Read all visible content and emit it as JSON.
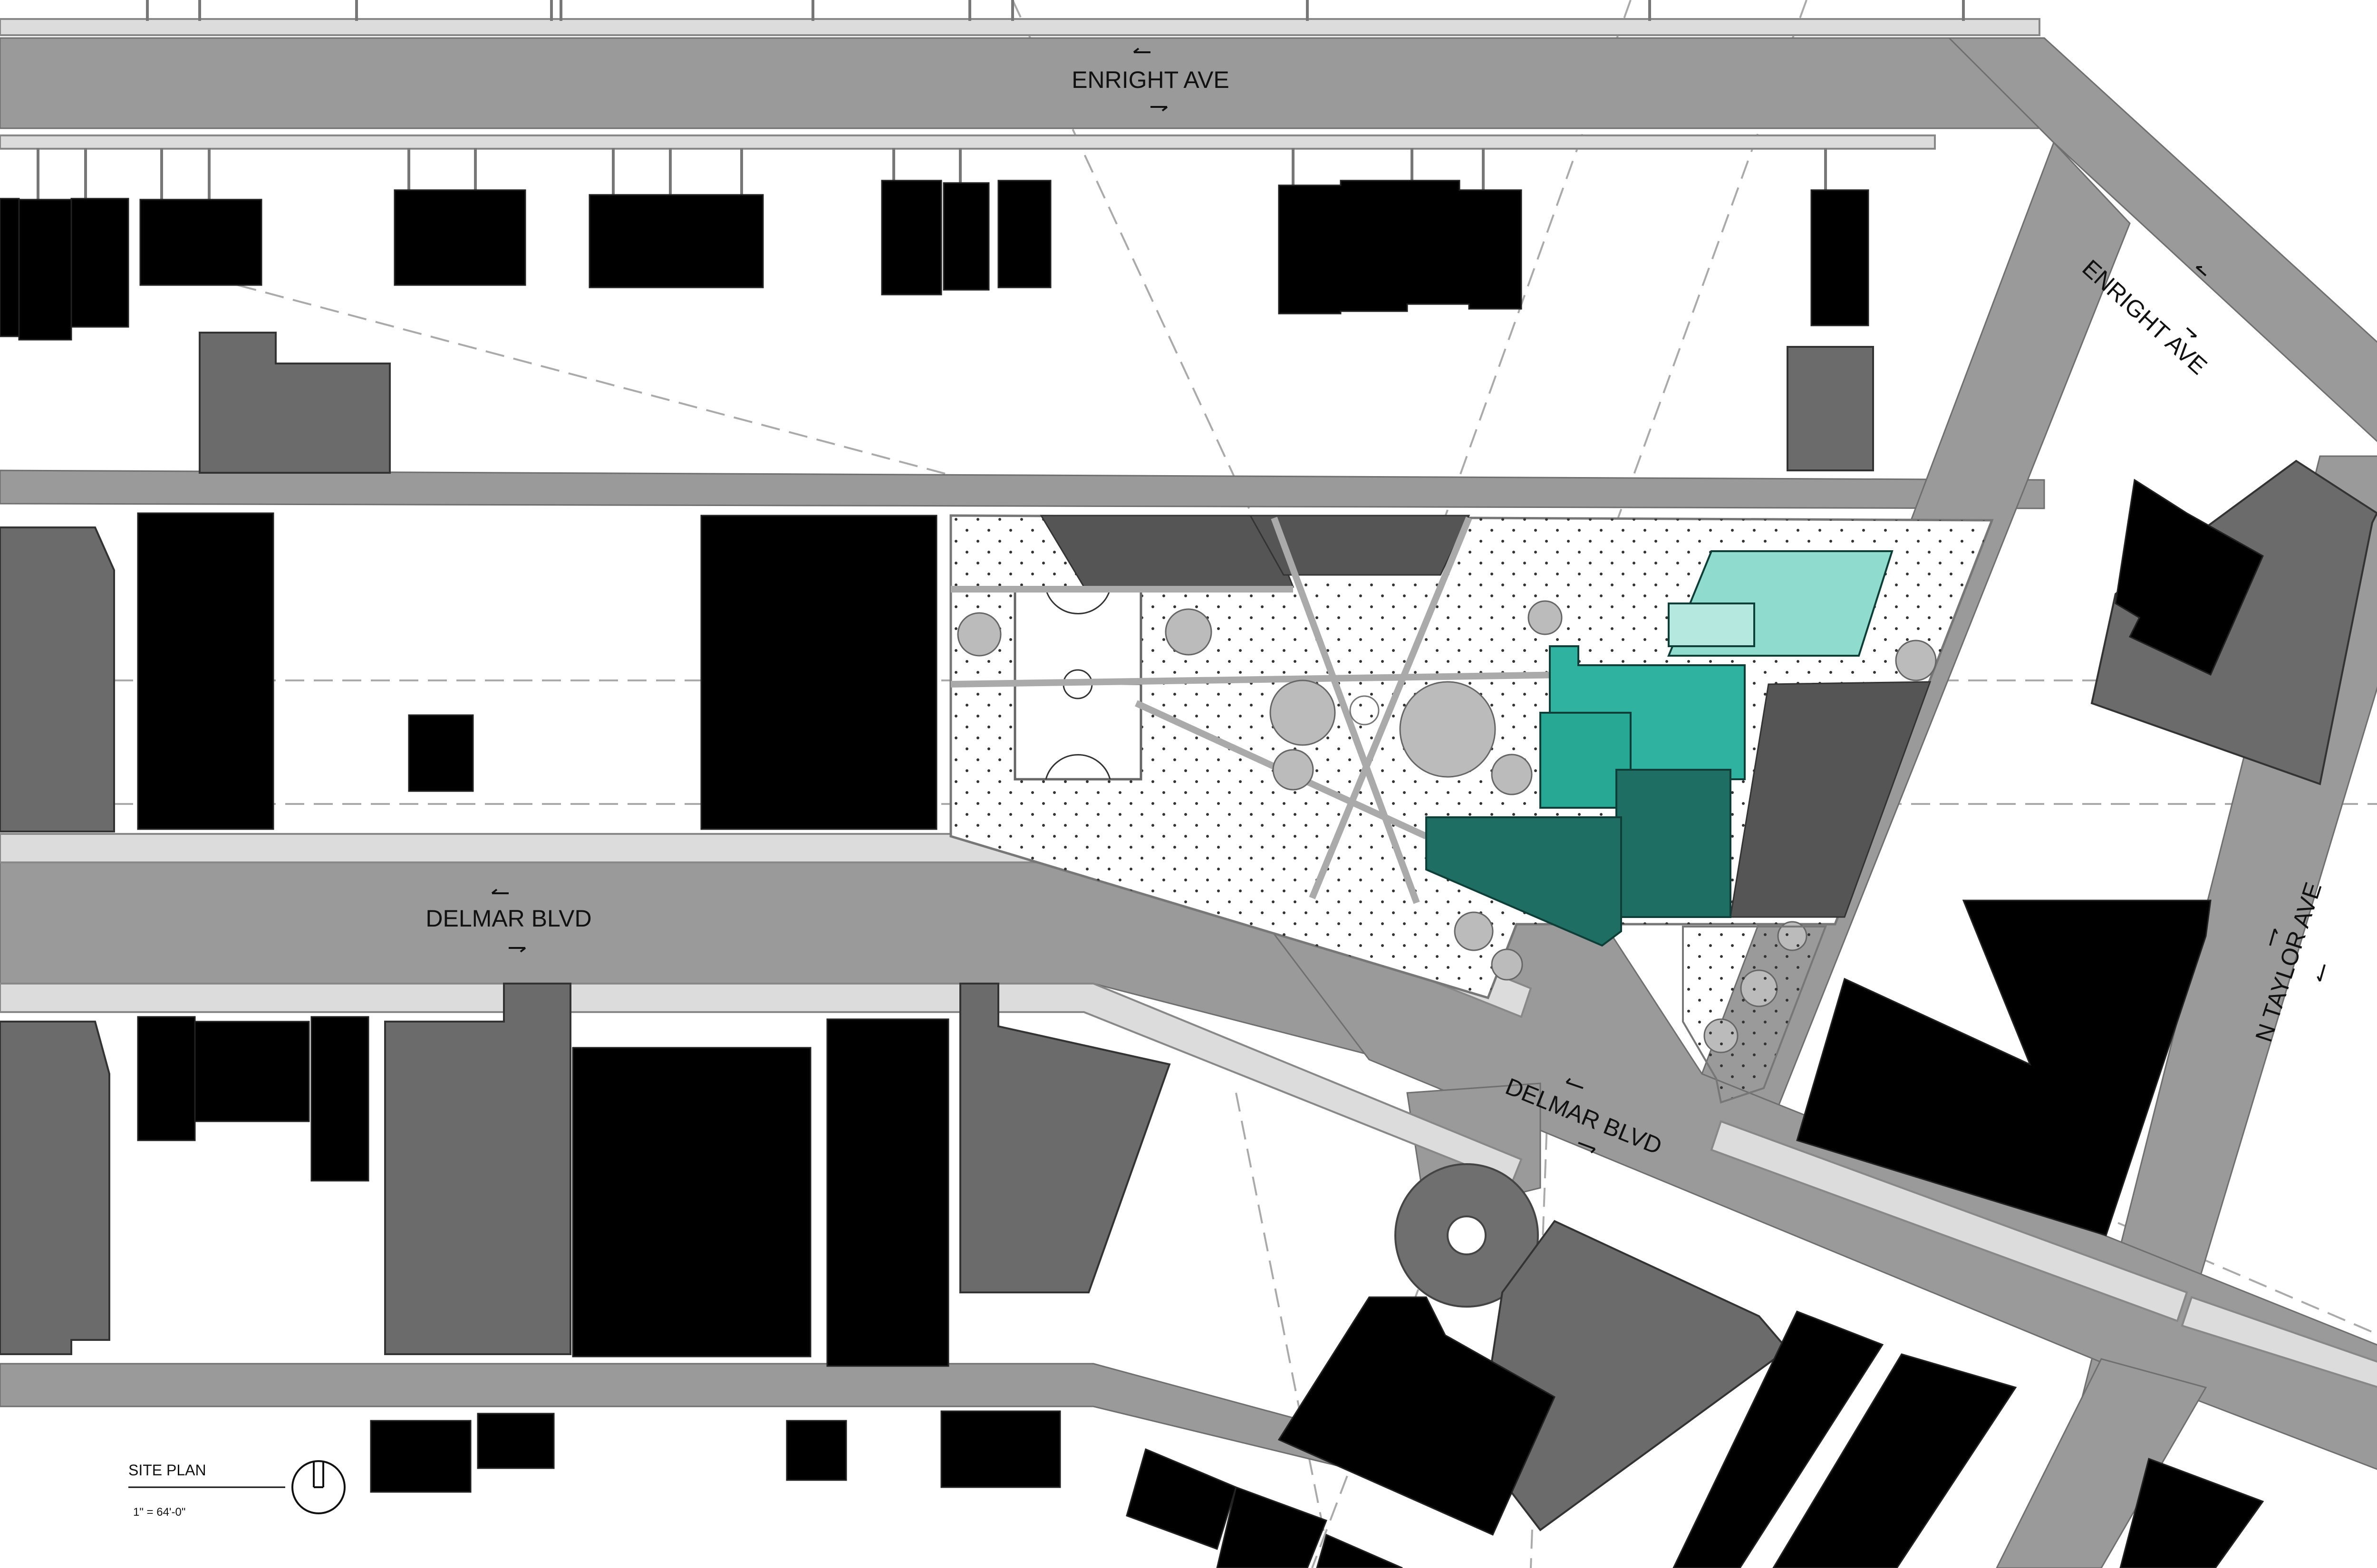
{
  "plan": {
    "title": "SITE PLAN",
    "scale": "1\" = 64'-0\""
  },
  "streets": {
    "enright_top": "ENRIGHT AVE",
    "enright_diag": "ENRIGHT AVE",
    "delmar_west": "DELMAR BLVD",
    "delmar_east": "DELMAR BLVD",
    "taylor": "N TAYLOR AVE"
  },
  "colors": {
    "road": "#9a9a9a",
    "sidewalk": "#dcdcdc",
    "building_black": "#000000",
    "building_gray": "#6b6b6b",
    "parking": "#555555",
    "teal_light": "#8fdccf",
    "teal_mid": "#2fb3a0",
    "teal_dark": "#1f6e63",
    "teal_darker": "#175a51"
  }
}
